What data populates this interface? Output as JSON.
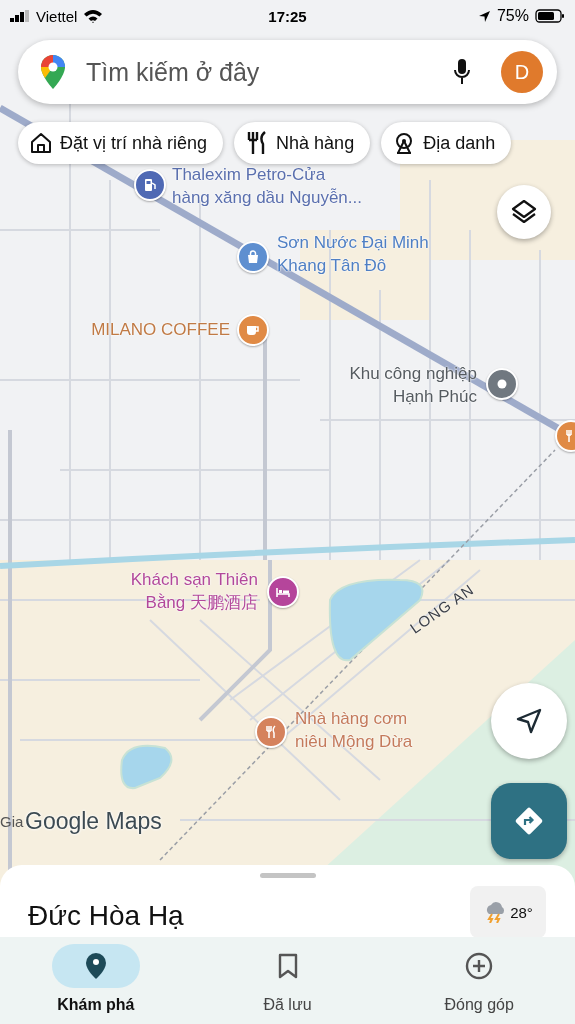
{
  "status_bar": {
    "carrier": "Viettel",
    "time": "17:25",
    "battery": "75%"
  },
  "search": {
    "placeholder": "Tìm kiếm ở đây",
    "avatar": "D"
  },
  "chips": [
    {
      "label": "Đặt vị trí nhà riêng",
      "kind": "home"
    },
    {
      "label": "Nhà hàng",
      "kind": "restaurant"
    },
    {
      "label": "Địa danh",
      "kind": "landmark"
    }
  ],
  "map": {
    "places": [
      {
        "name": "Thalexim Petro-Cửa hàng xăng dầu Nguyễn...",
        "kind": "fuel",
        "color": "#4f69b4"
      },
      {
        "name": "Sơn Nước Đại Minh Khang Tân Đô",
        "kind": "shop",
        "color": "#5e8fd0"
      },
      {
        "name": "MILANO COFFEE",
        "kind": "cafe",
        "color": "#e08a45"
      },
      {
        "name": "Khu công nghiệp Hạnh Phúc",
        "kind": "industrial",
        "color": "#707880"
      },
      {
        "name": "Khách sạn Thiên Bằng 天鹏酒店",
        "kind": "hotel",
        "color": "#b5459b"
      },
      {
        "name": "Nhà hàng cơm niêu Mộng Dừa",
        "kind": "restaurant",
        "color": "#d5825c"
      }
    ],
    "road_label": "LONG AN",
    "edge_label": "Gia",
    "attribution": "Google Maps"
  },
  "place": {
    "title": "Đức Hòa Hạ",
    "temperature": "28°"
  },
  "nav": [
    {
      "label": "Khám phá",
      "kind": "explore",
      "selected": true
    },
    {
      "label": "Đã lưu",
      "kind": "saved",
      "selected": false
    },
    {
      "label": "Đóng góp",
      "kind": "contribute",
      "selected": false
    }
  ]
}
